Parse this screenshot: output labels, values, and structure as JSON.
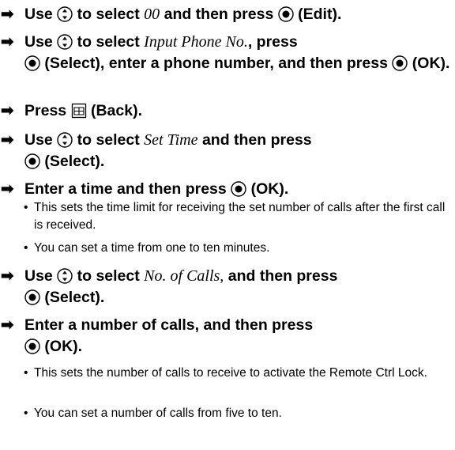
{
  "glyphs": {
    "arrow": "➡",
    "bullet": "•"
  },
  "steps": [
    {
      "a": "Use",
      "b": "to select",
      "em": "00",
      "c": "and then press",
      "d": "(Edit)."
    },
    {
      "a": "Use",
      "b": "to select",
      "em": "Input Phone No.",
      "c": ", press",
      "d": "(Select), enter a phone number, and then press",
      "e": "(OK)."
    },
    {
      "a": "Press",
      "d": "(Back)."
    },
    {
      "a": "Use",
      "b": "to select",
      "em": "Set Time",
      "c": "and then press",
      "d": "(Select)."
    },
    {
      "a": "Enter a time and then press",
      "d": "(OK)."
    },
    {
      "a": "Use",
      "b": "to select",
      "em": "No. of Calls,",
      "c": "and then press",
      "d": "(Select)."
    },
    {
      "a": "Enter a number of calls, and then press",
      "d": "(OK)."
    }
  ],
  "notes": {
    "time_limit": "This sets the time limit for receiving the set number of calls after the first call is received.",
    "time_range": "You can set a time from one to ten minutes.",
    "calls_activate": "This sets the number of calls to receive to activate the Remote Ctrl Lock.",
    "calls_range": "You can set a number of calls from five to ten."
  },
  "icons": [
    "navigation-key-icon",
    "center-key-icon",
    "phonebook-key-icon"
  ]
}
